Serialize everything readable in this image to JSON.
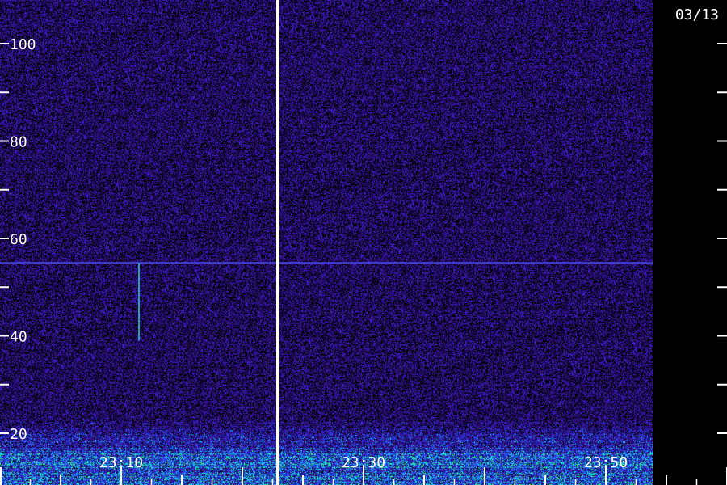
{
  "date_label": "03/13",
  "chart_data": {
    "type": "heatmap",
    "title": "",
    "xlabel": "",
    "ylabel": "",
    "y_ticks": [
      {
        "value": 20,
        "label": "20"
      },
      {
        "value": 30,
        "label": ""
      },
      {
        "value": 40,
        "label": "40"
      },
      {
        "value": 50,
        "label": ""
      },
      {
        "value": 60,
        "label": "60"
      },
      {
        "value": 70,
        "label": ""
      },
      {
        "value": 80,
        "label": "80"
      },
      {
        "value": 90,
        "label": ""
      },
      {
        "value": 100,
        "label": "100"
      }
    ],
    "ylim": [
      15,
      107
    ],
    "x_ticks": [
      {
        "value": "23:10",
        "label": "23:10"
      },
      {
        "value": "23:30",
        "label": "23:30"
      },
      {
        "value": "23:50",
        "label": "23:50"
      }
    ],
    "x_major_times": [
      "23:00",
      "23:10",
      "23:20",
      "23:30",
      "23:40",
      "23:50",
      "24:00"
    ],
    "marker_time": "23:19",
    "signals": [
      {
        "kind": "horizontal_line",
        "y": 55,
        "label": ""
      },
      {
        "kind": "vertical_line",
        "time": "23:05",
        "y_range": [
          39,
          55
        ],
        "label": ""
      }
    ],
    "colormap": [
      "#000000",
      "#2a0a6e",
      "#3c1ec8",
      "#1a5cff",
      "#14d2ff",
      "#28ff78"
    ],
    "colors": {
      "background": "#000000",
      "noise": "#3a1fa0",
      "axis": "#ffffff",
      "marker": "#ffffff"
    }
  }
}
